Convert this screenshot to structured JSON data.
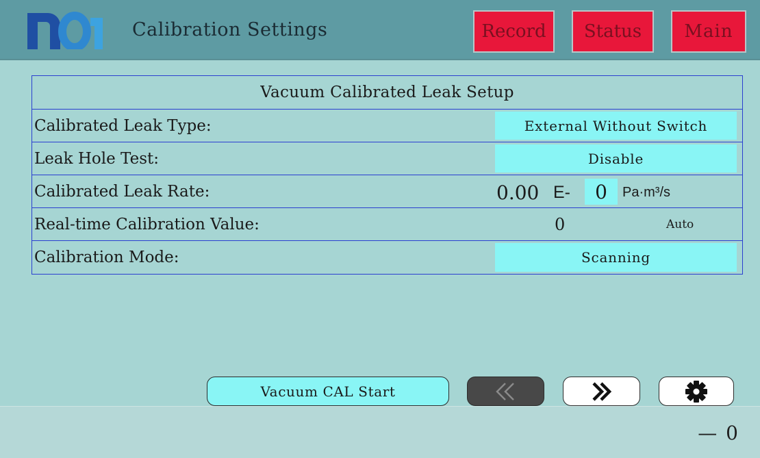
{
  "header": {
    "logo_alt": "nai",
    "title": "Calibration Settings",
    "buttons": {
      "record": "Record",
      "status": "Status",
      "main": "Main"
    }
  },
  "setup": {
    "title": "Vacuum Calibrated Leak Setup",
    "rows": {
      "leak_type": {
        "label": "Calibrated Leak Type:",
        "value": "External Without Switch"
      },
      "leak_hole_test": {
        "label": "Leak Hole Test:",
        "value": "Disable"
      },
      "leak_rate": {
        "label": "Calibrated Leak Rate:",
        "mantissa": "0.00",
        "e_symbol": "E-",
        "exponent": "0",
        "unit": "Pa·m³/s"
      },
      "realtime": {
        "label": "Real-time Calibration Value:",
        "value": "0",
        "mode": "Auto"
      },
      "cal_mode": {
        "label": "Calibration Mode:",
        "value": "Scanning"
      }
    }
  },
  "actions": {
    "start": "Vacuum CAL Start",
    "prev_icon": "double-chevron-left-icon",
    "next_icon": "double-chevron-right-icon",
    "settings_icon": "gear-icon"
  },
  "footer": {
    "reading": "— 0"
  },
  "colors": {
    "background": "#a6d5d3",
    "header": "#5e9ba3",
    "header_button": "#e8173a",
    "value_highlight": "#89f5f5",
    "table_border": "#2a3fd0",
    "footer": "#b5d8d7"
  }
}
